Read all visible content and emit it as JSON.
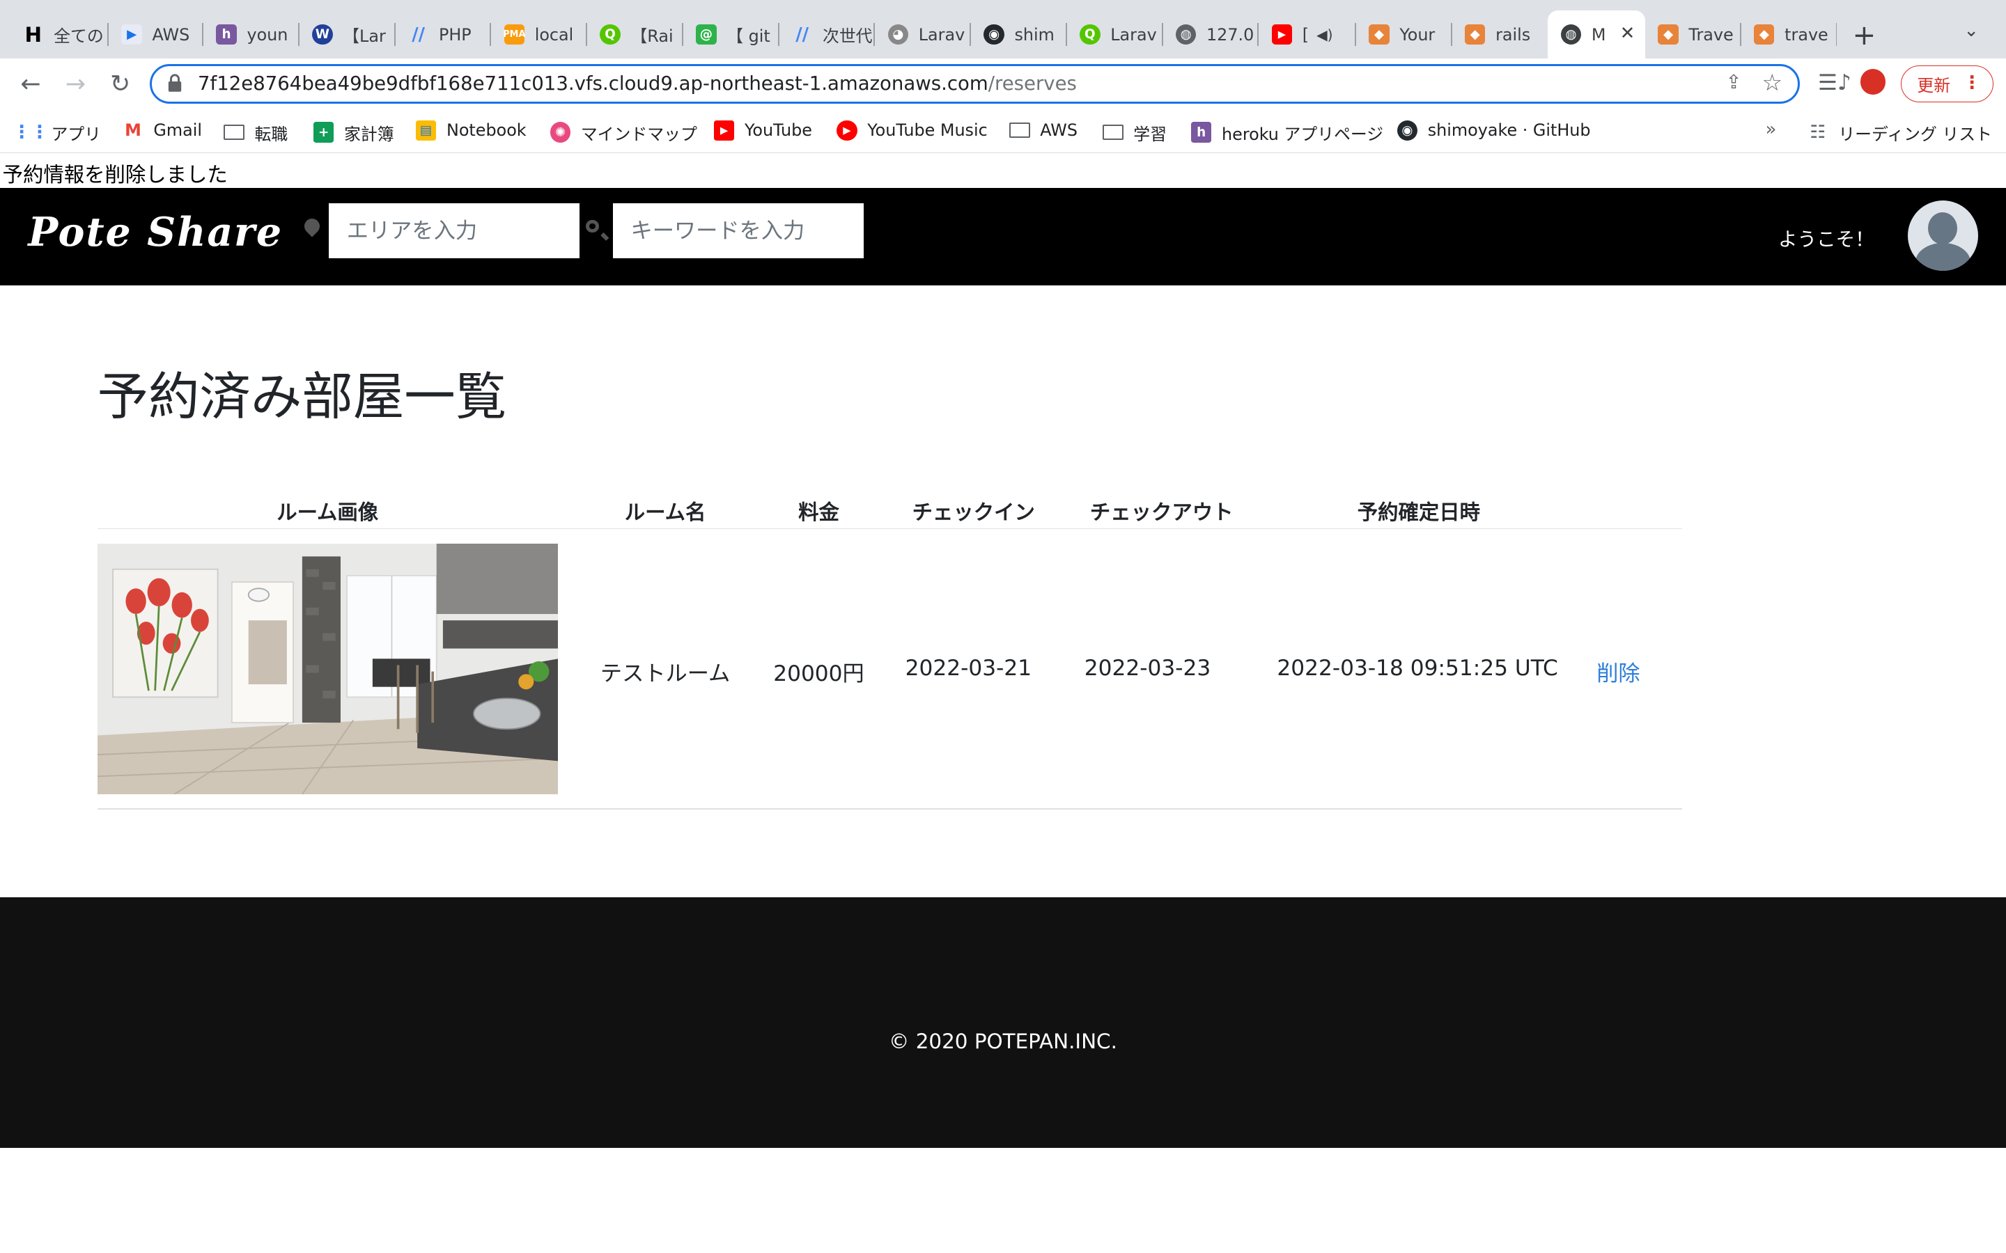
{
  "browser": {
    "tabs": [
      {
        "title": "全ての"
      },
      {
        "title": "AWS"
      },
      {
        "title": "youn"
      },
      {
        "title": "【Lar"
      },
      {
        "title": "PHP"
      },
      {
        "title": "local"
      },
      {
        "title": "【Rai"
      },
      {
        "title": "【 git"
      },
      {
        "title": "次世代"
      },
      {
        "title": "Larav"
      },
      {
        "title": "shim"
      },
      {
        "title": "Larav"
      },
      {
        "title": "127.0"
      },
      {
        "title": "["
      },
      {
        "title": "Your"
      },
      {
        "title": "rails"
      },
      {
        "title": "M"
      },
      {
        "title": "Trave"
      },
      {
        "title": "trave"
      }
    ],
    "url_host": "7f12e8764bea49be9dfbf168e711c013.vfs.cloud9.ap-northeast-1.amazonaws.com",
    "url_path": "/reserves",
    "update_label": "更新",
    "bookmarks": [
      {
        "label": "アプリ"
      },
      {
        "label": "Gmail"
      },
      {
        "label": "転職"
      },
      {
        "label": "家計簿"
      },
      {
        "label": "Notebook"
      },
      {
        "label": "マインドマップ"
      },
      {
        "label": "YouTube"
      },
      {
        "label": "YouTube Music"
      },
      {
        "label": "AWS"
      },
      {
        "label": "学習"
      },
      {
        "label": "heroku アプリページ"
      },
      {
        "label": "shimoyake · GitHub"
      }
    ],
    "bookmarks_more": "»",
    "reading_list": "リーディング リスト"
  },
  "flash": "予約情報を削除しました",
  "header": {
    "logo": "Pote Share",
    "area_placeholder": "エリアを入力",
    "keyword_placeholder": "キーワードを入力",
    "welcome": "ようこそ！"
  },
  "main": {
    "title": "予約済み部屋一覧",
    "columns": [
      "ルーム画像",
      "ルーム名",
      "料金",
      "チェックイン",
      "チェックアウト",
      "予約確定日時"
    ],
    "rows": [
      {
        "room_name": "テストルーム",
        "price": "20000円",
        "check_in": "2022-03-21",
        "check_out": "2022-03-23",
        "confirmed_at": "2022-03-18 09:51:25 UTC",
        "delete_label": "削除"
      }
    ]
  },
  "footer": {
    "copyright": "© 2020 POTEPAN.INC."
  }
}
